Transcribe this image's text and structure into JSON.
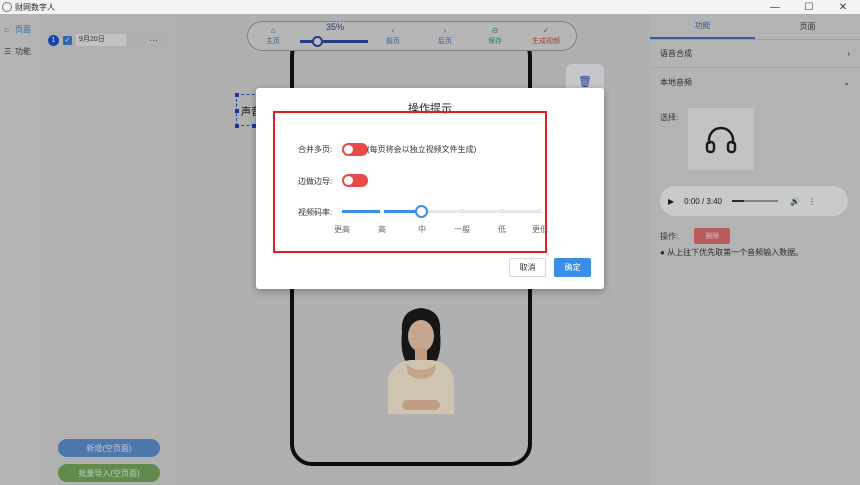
{
  "window": {
    "title": "财网数字人",
    "minimize": "—",
    "maximize": "☐",
    "close": "✕"
  },
  "nav": {
    "items": [
      {
        "label": "页面",
        "icon": "page-icon"
      },
      {
        "label": "功能",
        "icon": "function-icon"
      }
    ]
  },
  "pages": {
    "number": "1",
    "name": "9月20日",
    "more": "···"
  },
  "buttons": {
    "new_page": "新增(空页面)",
    "batch_import": "批量导入(空页面)"
  },
  "toolbar": {
    "zoom": "35%",
    "items": [
      {
        "label": "主页",
        "icon": "home-icon"
      },
      {
        "label": "前页",
        "icon": "prev-icon"
      },
      {
        "label": "后页",
        "icon": "next-icon"
      },
      {
        "label": "保存",
        "icon": "save-icon"
      },
      {
        "label": "生成视频",
        "icon": "check-icon"
      }
    ]
  },
  "canvas": {
    "text_box": "声音"
  },
  "right_panel": {
    "tabs": [
      "功能",
      "页面"
    ],
    "voice_synthesis": "语音合成",
    "local_audio": "本地音频",
    "select_label": "选择:",
    "player_time": "0:00 / 3:40",
    "operation_label": "操作:",
    "delete_label": "删除",
    "hint": "从上往下优先取第一个音频输入数据。"
  },
  "dialog": {
    "title": "操作提示",
    "merge_label": "合并多页:",
    "merge_note": "(每页将会以独立视频文件生成)",
    "edge_label": "边做边导:",
    "bitrate_label": "视频码率:",
    "bitrate_levels": [
      "更高",
      "高",
      "中",
      "一般",
      "低",
      "更低"
    ],
    "bitrate_selected": "中",
    "cancel": "取消",
    "confirm": "确定"
  },
  "colors": {
    "accent": "#3a8ee6",
    "toggle": "#e84a4a",
    "highlight_frame": "#e02020"
  }
}
